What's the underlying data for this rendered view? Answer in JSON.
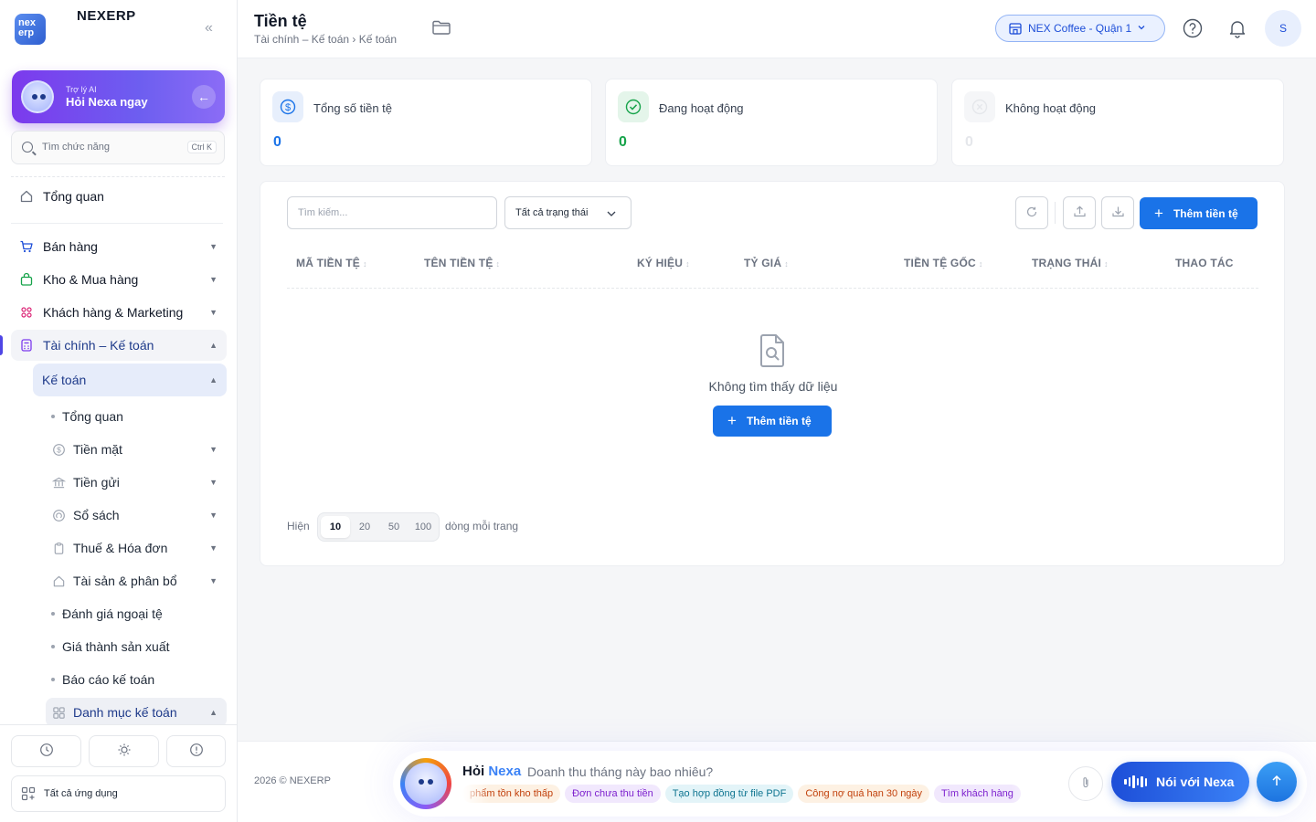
{
  "app": {
    "logo_text_top": "nex",
    "logo_text_bottom": "erp",
    "name": "NEXERP"
  },
  "ai_card": {
    "small_label": "Trợ lý AI",
    "title": "Hỏi Nexa ngay"
  },
  "side_search": {
    "placeholder": "Tìm chức năng",
    "shortcut": "Ctrl K"
  },
  "nav": {
    "overview": "Tổng quan",
    "sales": "Bán hàng",
    "inventory": "Kho & Mua hàng",
    "customers": "Khách hàng & Marketing",
    "finance": "Tài chính – Kế toán",
    "accounting": "Kế toán",
    "sub": {
      "overview": "Tổng quan",
      "cash": "Tiền mặt",
      "deposit": "Tiền gửi",
      "books": "Sổ sách",
      "tax": "Thuế & Hóa đơn",
      "assets": "Tài sản & phân bổ",
      "fx": "Đánh giá ngoại tệ",
      "cost": "Giá thành sản xuất",
      "reports": "Báo cáo kế toán",
      "catalog": "Danh mục kế toán"
    },
    "all_apps": "Tất cả ứng dụng"
  },
  "header": {
    "title": "Tiền tệ",
    "breadcrumb": "Tài chính – Kế toán › Kế toán",
    "branch": "NEX Coffee - Quận 1",
    "avatar": "S"
  },
  "stats": [
    {
      "label": "Tổng số tiền tệ",
      "value": "0",
      "color": "#1a73e8"
    },
    {
      "label": "Đang hoạt động",
      "value": "0",
      "color": "#16a34a"
    },
    {
      "label": "Không hoạt động",
      "value": "0",
      "color": "#d1d5db"
    }
  ],
  "toolbar": {
    "search_placeholder": "Tìm kiếm...",
    "status_filter": "Tất cả trạng thái",
    "add_label": "Thêm tiền tệ"
  },
  "table": {
    "columns": [
      "MÃ TIỀN TỆ",
      "TÊN TIỀN TỆ",
      "KÝ HIỆU",
      "TỶ GIÁ",
      "TIỀN TỆ GỐC",
      "TRẠNG THÁI",
      "THAO TÁC"
    ],
    "empty_text": "Không tìm thấy dữ liệu",
    "empty_add_label": "Thêm tiền tệ"
  },
  "pagination": {
    "prefix": "Hiện",
    "options": [
      "10",
      "20",
      "50",
      "100"
    ],
    "selected": "10",
    "suffix": "dòng mỗi trang"
  },
  "footer": {
    "copyright": "2026 © NEXERP"
  },
  "nexa": {
    "ask_prefix": "Hỏi",
    "ask_brand": "Nexa",
    "question": "Doanh thu tháng này bao nhiêu?",
    "chips": [
      {
        "label": "phẩm tồn kho thấp",
        "bg": "#fdf1e3",
        "fg": "#c2410c"
      },
      {
        "label": "Đơn chưa thu tiền",
        "bg": "#f1e8fd",
        "fg": "#7e22ce"
      },
      {
        "label": "Tạo hợp đồng từ file PDF",
        "bg": "#e3f4f8",
        "fg": "#0e7490"
      },
      {
        "label": "Công nợ quá hạn 30 ngày",
        "bg": "#fdf1e3",
        "fg": "#c2410c"
      },
      {
        "label": "Tìm khách hàng",
        "bg": "#f1e8fd",
        "fg": "#7e22ce"
      }
    ],
    "voice_label": "Nói với Nexa"
  }
}
